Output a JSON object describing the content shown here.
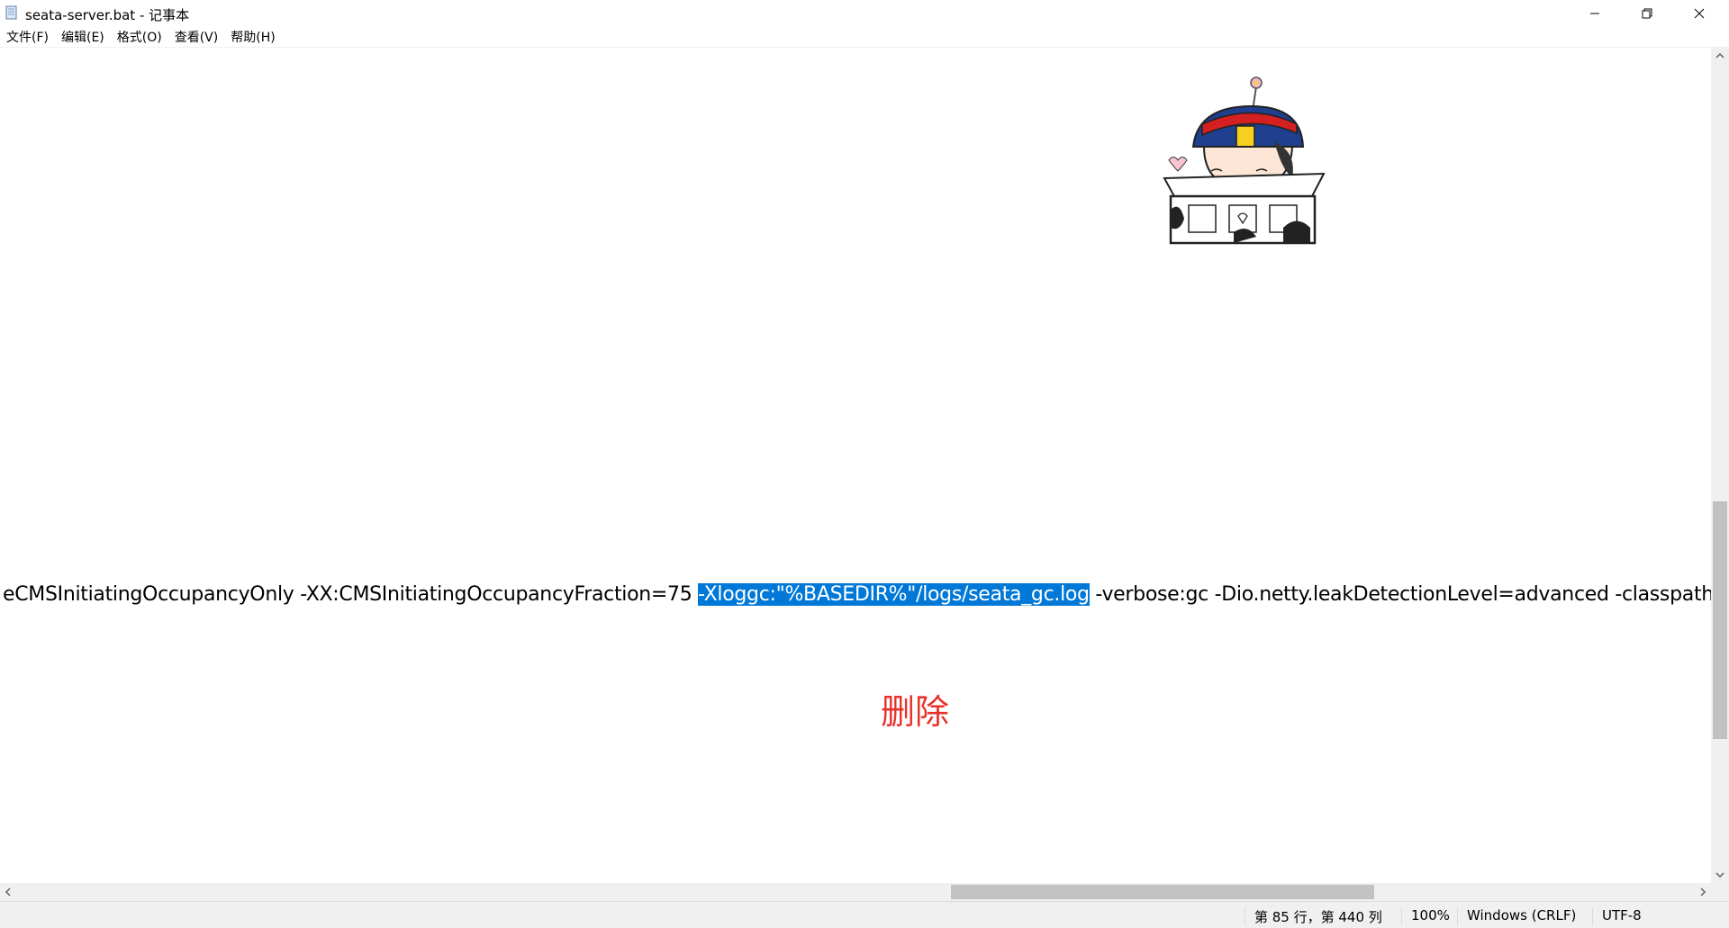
{
  "window": {
    "title": "seata-server.bat - 记事本"
  },
  "menu": {
    "file": "文件(F)",
    "edit": "编辑(E)",
    "format": "格式(O)",
    "view": "查看(V)",
    "help": "帮助(H)"
  },
  "editor": {
    "text_before": "eCMSInitiatingOccupancyOnly -XX:CMSInitiatingOccupancyFraction=75 ",
    "text_selected": "-Xloggc:\"%BASEDIR%\"/logs/seata_gc.log",
    "text_after": " -verbose:gc -Dio.netty.leakDetectionLevel=advanced -classpath %CLASSPATH% -Da",
    "annotation": "删除",
    "annotation_color": "#e8322c",
    "selection_color": "#0078d7"
  },
  "statusbar": {
    "position": "第 85 行，第 440 列",
    "zoom": "100%",
    "line_ending": "Windows (CRLF)",
    "encoding": "UTF-8"
  }
}
